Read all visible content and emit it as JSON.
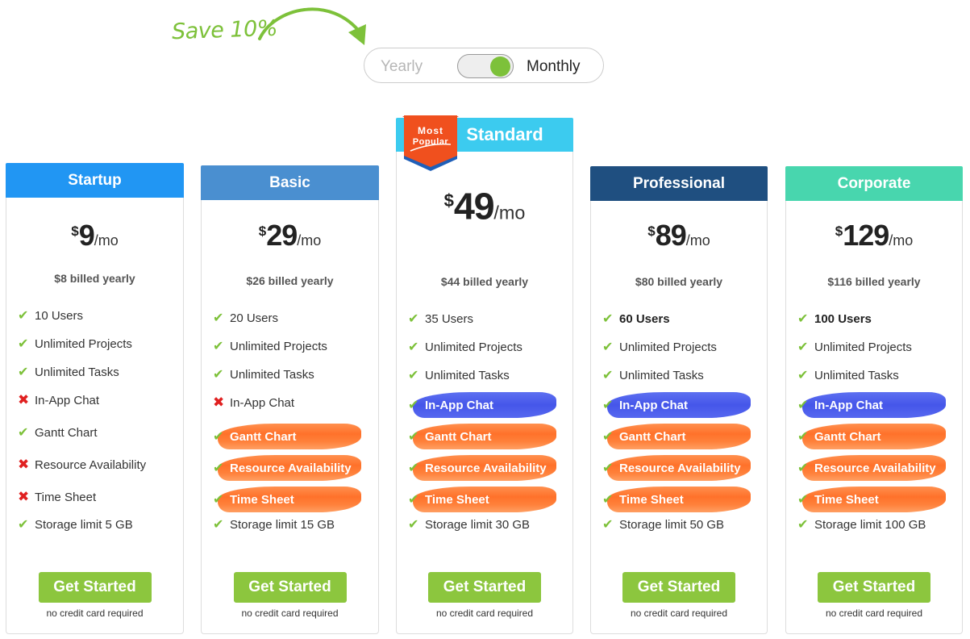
{
  "promo": {
    "save_note": "Save 10%",
    "arrow_icon": "curved-arrow"
  },
  "billing_toggle": {
    "yearly_label": "Yearly",
    "monthly_label": "Monthly",
    "selected": "Monthly"
  },
  "badge": {
    "line1": "Most",
    "line2": "Popular"
  },
  "colors": {
    "accent_green": "#8cc63e",
    "highlight_orange": "#ff6f2a",
    "highlight_blue": "#4254ea",
    "check": "#7dc13a",
    "cross": "#e02020"
  },
  "plans": [
    {
      "name": "Startup",
      "header_color": "#2196f3",
      "currency": "$",
      "price": "9",
      "period": "/mo",
      "billed_yearly": "$8 billed yearly",
      "features": [
        {
          "label": "10 Users",
          "included": true,
          "bold": false,
          "highlight": ""
        },
        {
          "label": "Unlimited Projects",
          "included": true,
          "bold": false,
          "highlight": ""
        },
        {
          "label": "Unlimited Tasks",
          "included": true,
          "bold": false,
          "highlight": ""
        },
        {
          "label": "In-App Chat",
          "included": false,
          "bold": false,
          "highlight": ""
        },
        {
          "label": "Gantt Chart",
          "included": true,
          "bold": false,
          "highlight": ""
        },
        {
          "label": "Resource Availability",
          "included": false,
          "bold": false,
          "highlight": ""
        },
        {
          "label": "Time Sheet",
          "included": false,
          "bold": false,
          "highlight": ""
        },
        {
          "label": "Storage limit 5 GB",
          "included": true,
          "bold": false,
          "highlight": ""
        }
      ],
      "cta": "Get Started",
      "note": "no credit card required"
    },
    {
      "name": "Basic",
      "header_color": "#4a8fd0",
      "currency": "$",
      "price": "29",
      "period": "/mo",
      "billed_yearly": "$26 billed yearly",
      "features": [
        {
          "label": "20 Users",
          "included": true,
          "bold": false,
          "highlight": ""
        },
        {
          "label": "Unlimited Projects",
          "included": true,
          "bold": false,
          "highlight": ""
        },
        {
          "label": "Unlimited Tasks",
          "included": true,
          "bold": false,
          "highlight": ""
        },
        {
          "label": "In-App Chat",
          "included": false,
          "bold": false,
          "highlight": ""
        },
        {
          "label": "Gantt Chart",
          "included": true,
          "bold": false,
          "highlight": "orange"
        },
        {
          "label": "Resource Availability",
          "included": true,
          "bold": false,
          "highlight": "orange"
        },
        {
          "label": "Time Sheet",
          "included": true,
          "bold": false,
          "highlight": "orange"
        },
        {
          "label": "Storage limit 15 GB",
          "included": true,
          "bold": false,
          "highlight": ""
        }
      ],
      "cta": "Get Started",
      "note": "no credit card required"
    },
    {
      "name": "Standard",
      "header_color": "#3ccbef",
      "currency": "$",
      "price": "49",
      "period": "/mo",
      "billed_yearly": "$44 billed yearly",
      "features": [
        {
          "label": "35 Users",
          "included": true,
          "bold": false,
          "highlight": ""
        },
        {
          "label": "Unlimited Projects",
          "included": true,
          "bold": false,
          "highlight": ""
        },
        {
          "label": "Unlimited Tasks",
          "included": true,
          "bold": false,
          "highlight": ""
        },
        {
          "label": "In-App Chat",
          "included": true,
          "bold": false,
          "highlight": "blue"
        },
        {
          "label": "Gantt Chart",
          "included": true,
          "bold": false,
          "highlight": "orange"
        },
        {
          "label": "Resource Availability",
          "included": true,
          "bold": false,
          "highlight": "orange"
        },
        {
          "label": "Time Sheet",
          "included": true,
          "bold": false,
          "highlight": "orange"
        },
        {
          "label": "Storage limit 30 GB",
          "included": true,
          "bold": false,
          "highlight": ""
        }
      ],
      "cta": "Get Started",
      "note": "no credit card required"
    },
    {
      "name": "Professional",
      "header_color": "#1f4f80",
      "currency": "$",
      "price": "89",
      "period": "/mo",
      "billed_yearly": "$80 billed yearly",
      "features": [
        {
          "label": "60 Users",
          "included": true,
          "bold": true,
          "highlight": ""
        },
        {
          "label": "Unlimited Projects",
          "included": true,
          "bold": false,
          "highlight": ""
        },
        {
          "label": "Unlimited Tasks",
          "included": true,
          "bold": false,
          "highlight": ""
        },
        {
          "label": "In-App Chat",
          "included": true,
          "bold": false,
          "highlight": "blue"
        },
        {
          "label": "Gantt Chart",
          "included": true,
          "bold": false,
          "highlight": "orange"
        },
        {
          "label": "Resource Availability",
          "included": true,
          "bold": false,
          "highlight": "orange"
        },
        {
          "label": "Time Sheet",
          "included": true,
          "bold": false,
          "highlight": "orange"
        },
        {
          "label": "Storage limit 50 GB",
          "included": true,
          "bold": false,
          "highlight": ""
        }
      ],
      "cta": "Get Started",
      "note": "no credit card required"
    },
    {
      "name": "Corporate",
      "header_color": "#48d6ae",
      "currency": "$",
      "price": "129",
      "period": "/mo",
      "billed_yearly": "$116 billed yearly",
      "features": [
        {
          "label": "100 Users",
          "included": true,
          "bold": true,
          "highlight": ""
        },
        {
          "label": "Unlimited Projects",
          "included": true,
          "bold": false,
          "highlight": ""
        },
        {
          "label": "Unlimited Tasks",
          "included": true,
          "bold": false,
          "highlight": ""
        },
        {
          "label": "In-App Chat",
          "included": true,
          "bold": false,
          "highlight": "blue"
        },
        {
          "label": "Gantt Chart",
          "included": true,
          "bold": false,
          "highlight": "orange"
        },
        {
          "label": "Resource Availability",
          "included": true,
          "bold": false,
          "highlight": "orange"
        },
        {
          "label": "Time Sheet",
          "included": true,
          "bold": false,
          "highlight": "orange"
        },
        {
          "label": "Storage limit 100 GB",
          "included": true,
          "bold": false,
          "highlight": ""
        }
      ],
      "cta": "Get Started",
      "note": "no credit card required"
    }
  ]
}
